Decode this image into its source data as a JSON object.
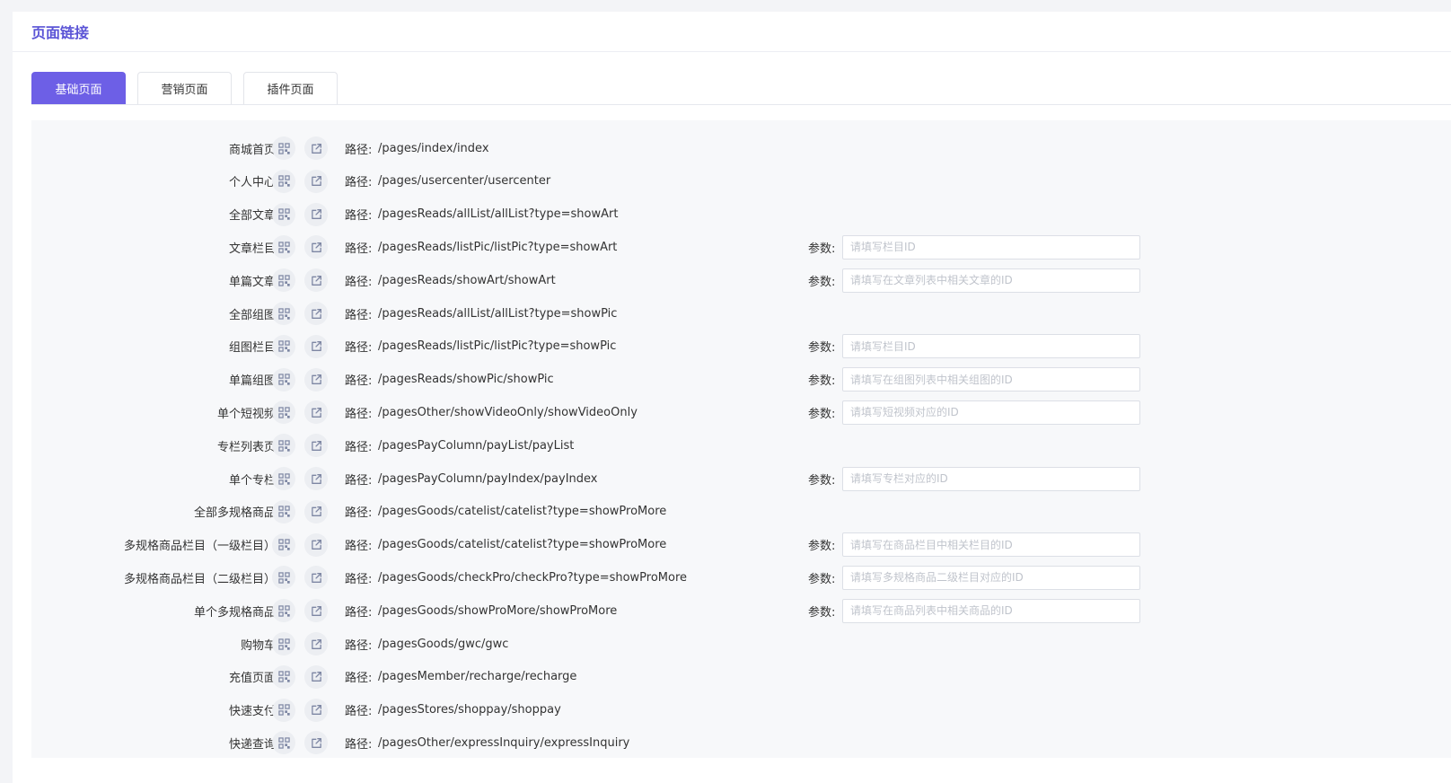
{
  "page": {
    "title": "页面链接"
  },
  "tabs": [
    {
      "label": "基础页面",
      "active": true
    },
    {
      "label": "营销页面",
      "active": false
    },
    {
      "label": "插件页面",
      "active": false
    }
  ],
  "labels": {
    "path_prefix": "路径:",
    "param_prefix": "参数:"
  },
  "icons": {
    "qr": "qr-code-icon",
    "share": "share-link-icon"
  },
  "colors": {
    "accent": "#6d5fe6",
    "title": "#5b54d6",
    "icon": "#7d86a3"
  },
  "rows": [
    {
      "label": "商城首页",
      "path": "/pages/index/index",
      "param_placeholder": null
    },
    {
      "label": "个人中心",
      "path": "/pages/usercenter/usercenter",
      "param_placeholder": null
    },
    {
      "label": "全部文章",
      "path": "/pagesReads/allList/allList?type=showArt",
      "param_placeholder": null
    },
    {
      "label": "文章栏目",
      "path": "/pagesReads/listPic/listPic?type=showArt",
      "param_placeholder": "请填写栏目ID"
    },
    {
      "label": "单篇文章",
      "path": "/pagesReads/showArt/showArt",
      "param_placeholder": "请填写在文章列表中相关文章的ID"
    },
    {
      "label": "全部组图",
      "path": "/pagesReads/allList/allList?type=showPic",
      "param_placeholder": null
    },
    {
      "label": "组图栏目",
      "path": "/pagesReads/listPic/listPic?type=showPic",
      "param_placeholder": "请填写栏目ID"
    },
    {
      "label": "单篇组图",
      "path": "/pagesReads/showPic/showPic",
      "param_placeholder": "请填写在组图列表中相关组图的ID"
    },
    {
      "label": "单个短视频",
      "path": "/pagesOther/showVideoOnly/showVideoOnly",
      "param_placeholder": "请填写短视频对应的ID"
    },
    {
      "label": "专栏列表页",
      "path": "/pagesPayColumn/payList/payList",
      "param_placeholder": null
    },
    {
      "label": "单个专栏",
      "path": "/pagesPayColumn/payIndex/payIndex",
      "param_placeholder": "请填写专栏对应的ID"
    },
    {
      "label": "全部多规格商品",
      "path": "/pagesGoods/catelist/catelist?type=showProMore",
      "param_placeholder": null
    },
    {
      "label": "多规格商品栏目（一级栏目）",
      "path": "/pagesGoods/catelist/catelist?type=showProMore",
      "param_placeholder": "请填写在商品栏目中相关栏目的ID"
    },
    {
      "label": "多规格商品栏目（二级栏目）",
      "path": "/pagesGoods/checkPro/checkPro?type=showProMore",
      "param_placeholder": "请填写多规格商品二级栏目对应的ID"
    },
    {
      "label": "单个多规格商品",
      "path": "/pagesGoods/showProMore/showProMore",
      "param_placeholder": "请填写在商品列表中相关商品的ID"
    },
    {
      "label": "购物车",
      "path": "/pagesGoods/gwc/gwc",
      "param_placeholder": null
    },
    {
      "label": "充值页面",
      "path": "/pagesMember/recharge/recharge",
      "param_placeholder": null
    },
    {
      "label": "快速支付",
      "path": "/pagesStores/shoppay/shoppay",
      "param_placeholder": null
    },
    {
      "label": "快递查询",
      "path": "/pagesOther/expressInquiry/expressInquiry",
      "param_placeholder": null
    }
  ]
}
